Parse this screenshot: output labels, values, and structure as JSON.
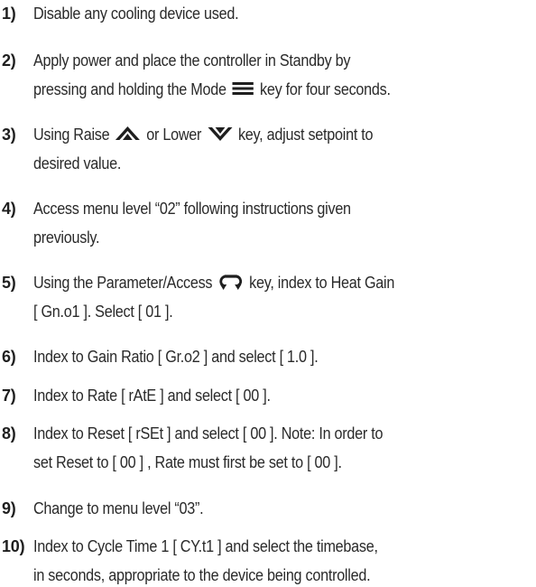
{
  "steps": [
    {
      "num": "1)",
      "lines": [
        [
          "Disable any cooling device used."
        ]
      ]
    },
    {
      "num": "2)",
      "lines": [
        [
          "Apply power and place the controller in Standby by"
        ],
        [
          "pressing and holding the Mode ",
          "menu-icon",
          " key for four seconds."
        ]
      ]
    },
    {
      "num": "3)",
      "lines": [
        [
          "Using Raise ",
          "raise-icon",
          " or Lower ",
          "lower-icon",
          " key, adjust setpoint to"
        ],
        [
          "desired value."
        ]
      ]
    },
    {
      "num": "4)",
      "lines": [
        [
          "Access menu level “02” following instructions given"
        ],
        [
          "previously."
        ]
      ]
    },
    {
      "num": "5)",
      "lines": [
        [
          "Using the Parameter/Access ",
          "parameter-access-icon",
          " key, index to Heat Gain"
        ],
        [
          "[ Gn.o1 ]. Select [ 01 ]."
        ]
      ]
    },
    {
      "num": "6)",
      "lines": [
        [
          "Index to Gain Ratio [ Gr.o2 ] and select [ 1.0 ]."
        ]
      ]
    },
    {
      "num": "7)",
      "lines": [
        [
          "Index to Rate [ rAtE ] and select [ 00 ]."
        ]
      ]
    },
    {
      "num": "8)",
      "lines": [
        [
          "Index to Reset [ rSEt ] and select [ 00 ]. Note: In order to"
        ],
        [
          "set Reset to [ 00 ] , Rate must first be set to [ 00 ]."
        ]
      ]
    },
    {
      "num": "9)",
      "lines": [
        [
          "Change to menu level “03”."
        ]
      ]
    },
    {
      "num": "10)",
      "lines": [
        [
          "Index to Cycle Time 1 [ CY.t1 ] and select the timebase,"
        ],
        [
          "in seconds, appropriate to the device being controlled."
        ]
      ]
    }
  ]
}
